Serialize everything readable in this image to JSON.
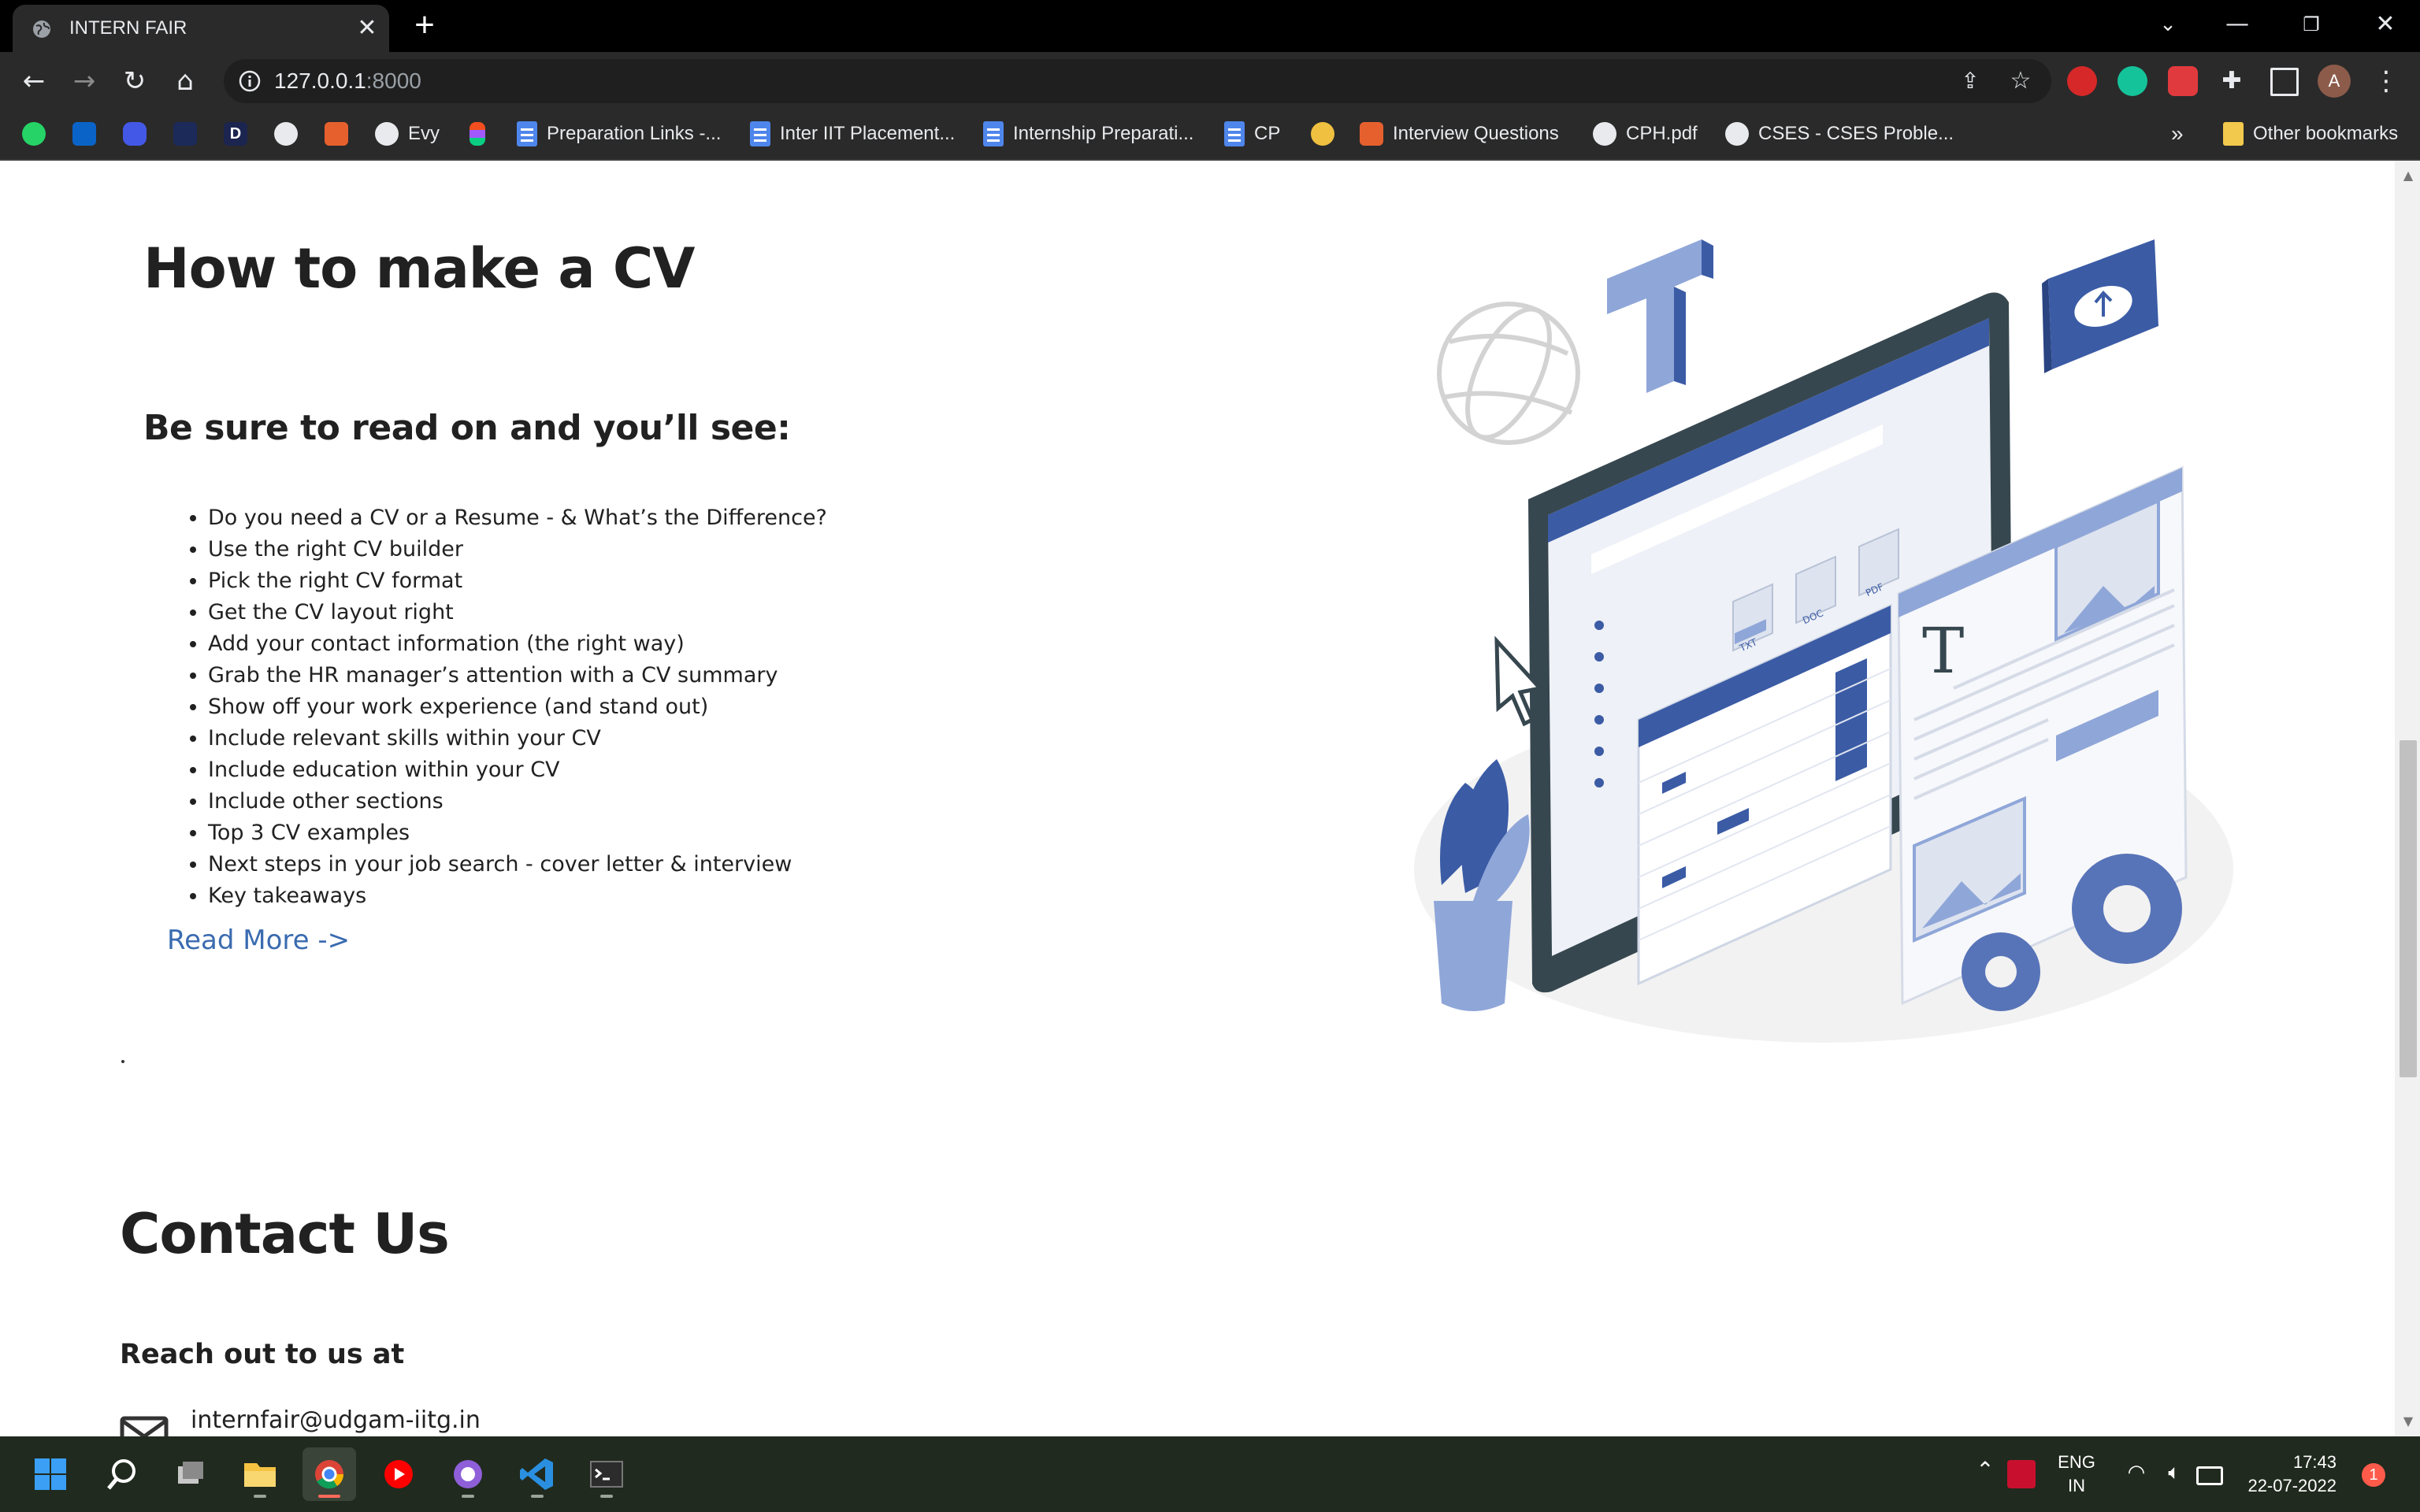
{
  "browser": {
    "tab_title": "INTERN FAIR",
    "url_host": "127.0.0.1",
    "url_port": ":8000",
    "profile_initial": "A",
    "bookmarks": [
      {
        "label": "Evy",
        "icon": "github-icon"
      },
      {
        "label": "Preparation Links -...",
        "icon": "google-doc-icon"
      },
      {
        "label": "Inter IIT Placement...",
        "icon": "google-doc-icon"
      },
      {
        "label": "Internship Preparati...",
        "icon": "google-doc-icon"
      },
      {
        "label": "CP",
        "icon": "google-doc-icon"
      },
      {
        "label": "Interview Questions",
        "icon": "bookmark-site-icon"
      },
      {
        "label": "CPH.pdf",
        "icon": "globe-icon"
      },
      {
        "label": "CSES - CSES Proble...",
        "icon": "globe-icon"
      }
    ],
    "bookmark_initial_d": "D",
    "overflow": "»",
    "other_bookmarks": "Other bookmarks"
  },
  "page": {
    "cv_title": "How to make a CV",
    "cv_subtitle": "Be sure to read on and you’ll see:",
    "topics": [
      "Do you need a CV or a Resume - & What’s the Difference?",
      "Use the right CV builder",
      "Pick the right CV format",
      "Get the CV layout right",
      "Add your contact information (the right way)",
      "Grab the HR manager’s attention with a CV summary",
      "Show off your work experience (and stand out)",
      "Include relevant skills within your CV",
      "Include education within your CV",
      "Include other sections",
      "Top 3 CV examples",
      "Next steps in your job search - cover letter & interview",
      "Key takeaways"
    ],
    "read_more": "Read More ->",
    "contact_title": "Contact Us",
    "contact_subtitle": "Reach out to us at",
    "contact_email": "internfair@udgam-iitg.in"
  },
  "illustration": {
    "file_labels": [
      "TXT",
      "DOC",
      "PDF"
    ],
    "text_glyph": "T",
    "colors": {
      "primary": "#3b5ba5",
      "light": "#8fa6d8",
      "dark": "#37474f"
    }
  },
  "taskbar": {
    "lang_top": "ENG",
    "lang_bottom": "IN",
    "time": "17:43",
    "date": "22-07-2022",
    "notification_count": "1"
  },
  "colors": {
    "link": "#3a6bb0",
    "text": "#212121",
    "chrome_dark": "#2a2a2a"
  }
}
